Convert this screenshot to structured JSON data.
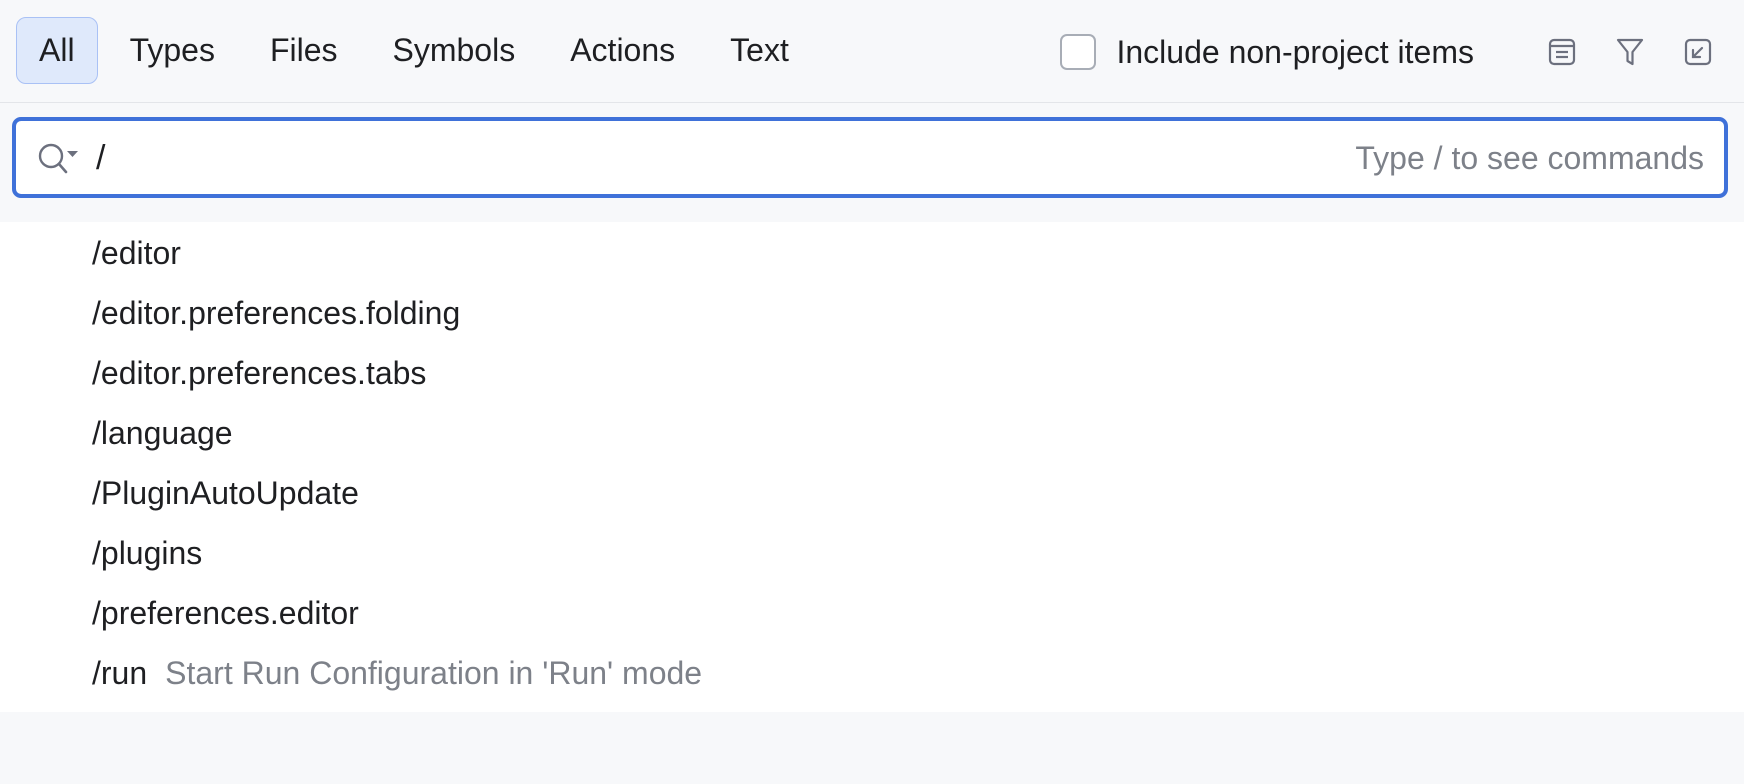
{
  "tabs": [
    {
      "label": "All",
      "selected": true
    },
    {
      "label": "Types",
      "selected": false
    },
    {
      "label": "Files",
      "selected": false
    },
    {
      "label": "Symbols",
      "selected": false
    },
    {
      "label": "Actions",
      "selected": false
    },
    {
      "label": "Text",
      "selected": false
    }
  ],
  "options": {
    "include_non_project_label": "Include non-project items",
    "include_non_project_checked": false
  },
  "toolbar_icons": [
    "preview-icon",
    "filter-icon",
    "collapse-to-corner-icon"
  ],
  "search": {
    "value": "/",
    "hint": "Type / to see commands"
  },
  "results": [
    {
      "command": "/editor",
      "description": ""
    },
    {
      "command": "/editor.preferences.folding",
      "description": ""
    },
    {
      "command": "/editor.preferences.tabs",
      "description": ""
    },
    {
      "command": "/language",
      "description": ""
    },
    {
      "command": "/PluginAutoUpdate",
      "description": ""
    },
    {
      "command": "/plugins",
      "description": ""
    },
    {
      "command": "/preferences.editor",
      "description": ""
    },
    {
      "command": "/run",
      "description": "Start Run Configuration in 'Run' mode"
    }
  ],
  "colors": {
    "accent": "#3f71d9",
    "tab_selected_bg": "#dfe9fb",
    "hint_text": "#7d8189"
  }
}
